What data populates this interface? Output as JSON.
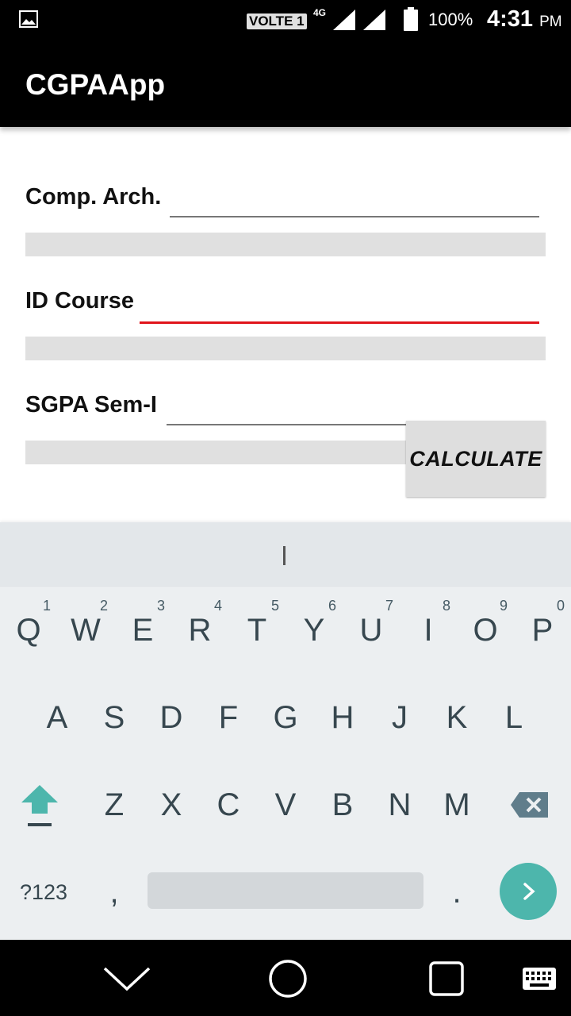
{
  "status_bar": {
    "volte": "VOLTE 1",
    "network": "4G",
    "battery": "100%",
    "time": "4:31",
    "ampm": "PM"
  },
  "app_bar": {
    "title": "CGPAApp"
  },
  "form": {
    "fields": [
      {
        "label": "Comp. Arch.",
        "value": ""
      },
      {
        "label": "ID Course",
        "value": ""
      },
      {
        "label": "SGPA Sem-I",
        "value": ""
      }
    ],
    "calculate_button": "CALCULATE"
  },
  "keyboard": {
    "row1": [
      {
        "key": "Q",
        "hint": "1"
      },
      {
        "key": "W",
        "hint": "2"
      },
      {
        "key": "E",
        "hint": "3"
      },
      {
        "key": "R",
        "hint": "4"
      },
      {
        "key": "T",
        "hint": "5"
      },
      {
        "key": "Y",
        "hint": "6"
      },
      {
        "key": "U",
        "hint": "7"
      },
      {
        "key": "I",
        "hint": "8"
      },
      {
        "key": "O",
        "hint": "9"
      },
      {
        "key": "P",
        "hint": "0"
      }
    ],
    "row2": [
      "A",
      "S",
      "D",
      "F",
      "G",
      "H",
      "J",
      "K",
      "L"
    ],
    "row3": [
      "Z",
      "X",
      "C",
      "V",
      "B",
      "N",
      "M"
    ],
    "symbols_key": "?123",
    "comma_key": ",",
    "period_key": ".",
    "accent_color": "#4db6ac"
  }
}
